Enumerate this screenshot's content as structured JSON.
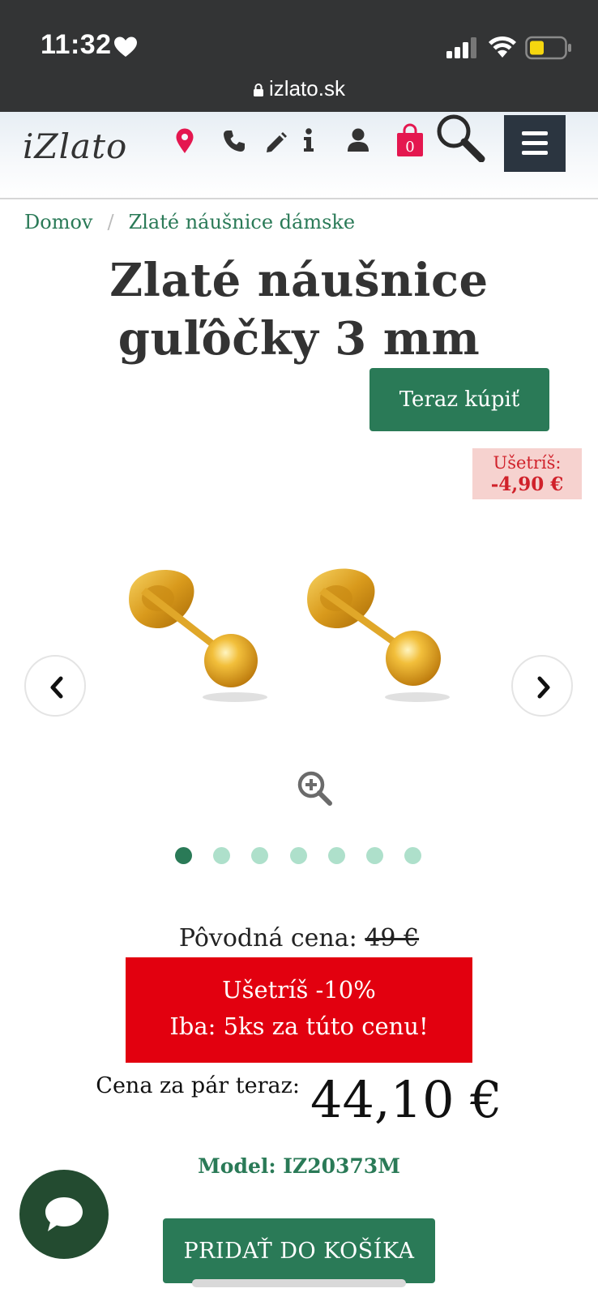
{
  "status_bar": {
    "time": "11:32",
    "url": "izlato.sk"
  },
  "header": {
    "logo": "iZlato",
    "cart_count": "0",
    "icons": [
      "location-pin-icon",
      "phone-icon",
      "pencil-icon",
      "info-icon",
      "user-icon",
      "shopping-bag-icon",
      "search-icon",
      "hamburger-menu-icon"
    ],
    "accent_color": "#e4174f",
    "menu_bg": "#2b3540"
  },
  "breadcrumb": {
    "items": [
      "Domov",
      "Zlaté náušnice dámske"
    ],
    "separator": "/"
  },
  "product": {
    "title": "Zlaté náušnice guľôčky 3 mm",
    "buy_now_label": "Teraz kúpiť",
    "save_badge_line1": "Ušetríš:",
    "save_badge_line2": "-4,90 €",
    "original_price_label": "Pôvodná cena:",
    "original_price": "49 €",
    "promo_line1": "Ušetríš -10%",
    "promo_line2": "Iba: 5ks za túto cenu!",
    "price_label": "Cena za pár teraz:",
    "price": "44,10 €",
    "model": "Model: IZ20373M",
    "add_to_cart_label": "PRIDAŤ DO KOŠÍKA"
  },
  "gallery": {
    "slide_count": 7,
    "active_slide": 1
  },
  "colors": {
    "brand_green": "#2a7a57",
    "promo_red": "#e2000f",
    "dot_inactive": "#aee0cb"
  }
}
